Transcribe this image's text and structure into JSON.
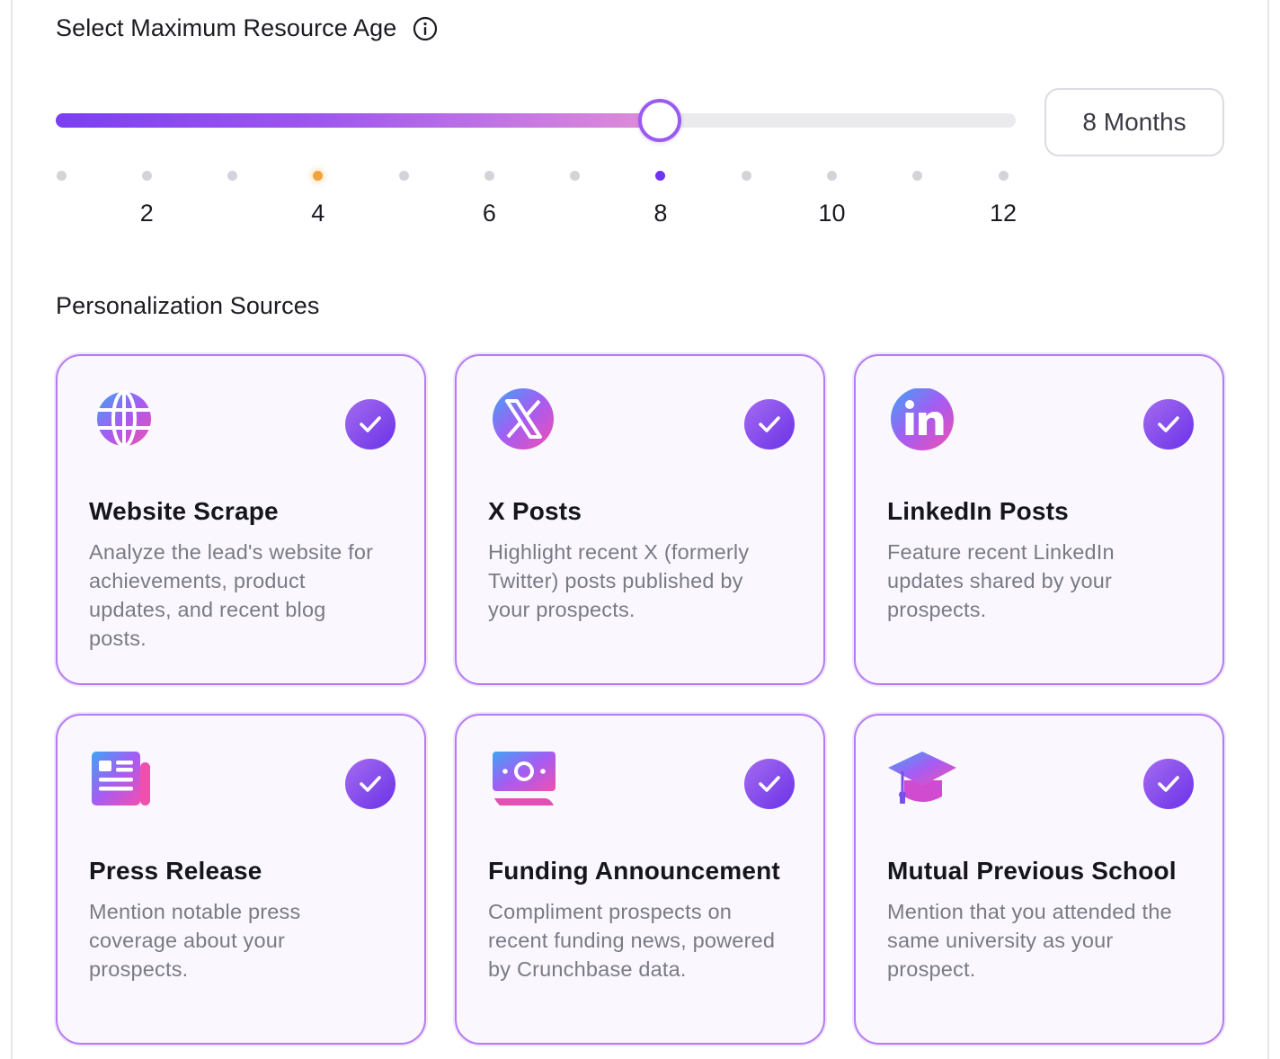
{
  "resource_age": {
    "title": "Select Maximum Resource Age",
    "info_icon": "info-circle-icon",
    "slider": {
      "min": 1,
      "max": 12,
      "value": 8,
      "marker_value": 4
    },
    "tick_labels": [
      "2",
      "4",
      "6",
      "8",
      "10",
      "12"
    ],
    "value_display": "8 Months"
  },
  "sources": {
    "title": "Personalization Sources",
    "cards": [
      {
        "id": "website-scrape",
        "icon": "globe-icon",
        "title": "Website Scrape",
        "description": "Analyze the lead's website for achievements, product updates, and recent blog posts.",
        "checked": true
      },
      {
        "id": "x-posts",
        "icon": "x-logo-icon",
        "title": "X Posts",
        "description": "Highlight recent X (formerly Twitter) posts published by your prospects.",
        "checked": true
      },
      {
        "id": "linkedin-posts",
        "icon": "linkedin-logo-icon",
        "title": "LinkedIn Posts",
        "description": "Feature recent LinkedIn updates shared by your prospects.",
        "checked": true
      },
      {
        "id": "press-release",
        "icon": "newspaper-icon",
        "title": "Press Release",
        "description": "Mention notable press coverage about your prospects.",
        "checked": true
      },
      {
        "id": "funding-announcement",
        "icon": "money-bill-icon",
        "title": "Funding Announcement",
        "description": "Compliment prospects on recent funding news, powered by Crunchbase data.",
        "checked": true
      },
      {
        "id": "mutual-previous-school",
        "icon": "graduation-cap-icon",
        "title": "Mutual Previous School",
        "description": "Mention that you attended the same university as your prospect.",
        "checked": true
      }
    ]
  },
  "colors": {
    "accent_purple": "#7033f5",
    "accent_pink": "#e08fd8",
    "marker_orange": "#f2a33c",
    "card_border": "#b57cf2"
  }
}
